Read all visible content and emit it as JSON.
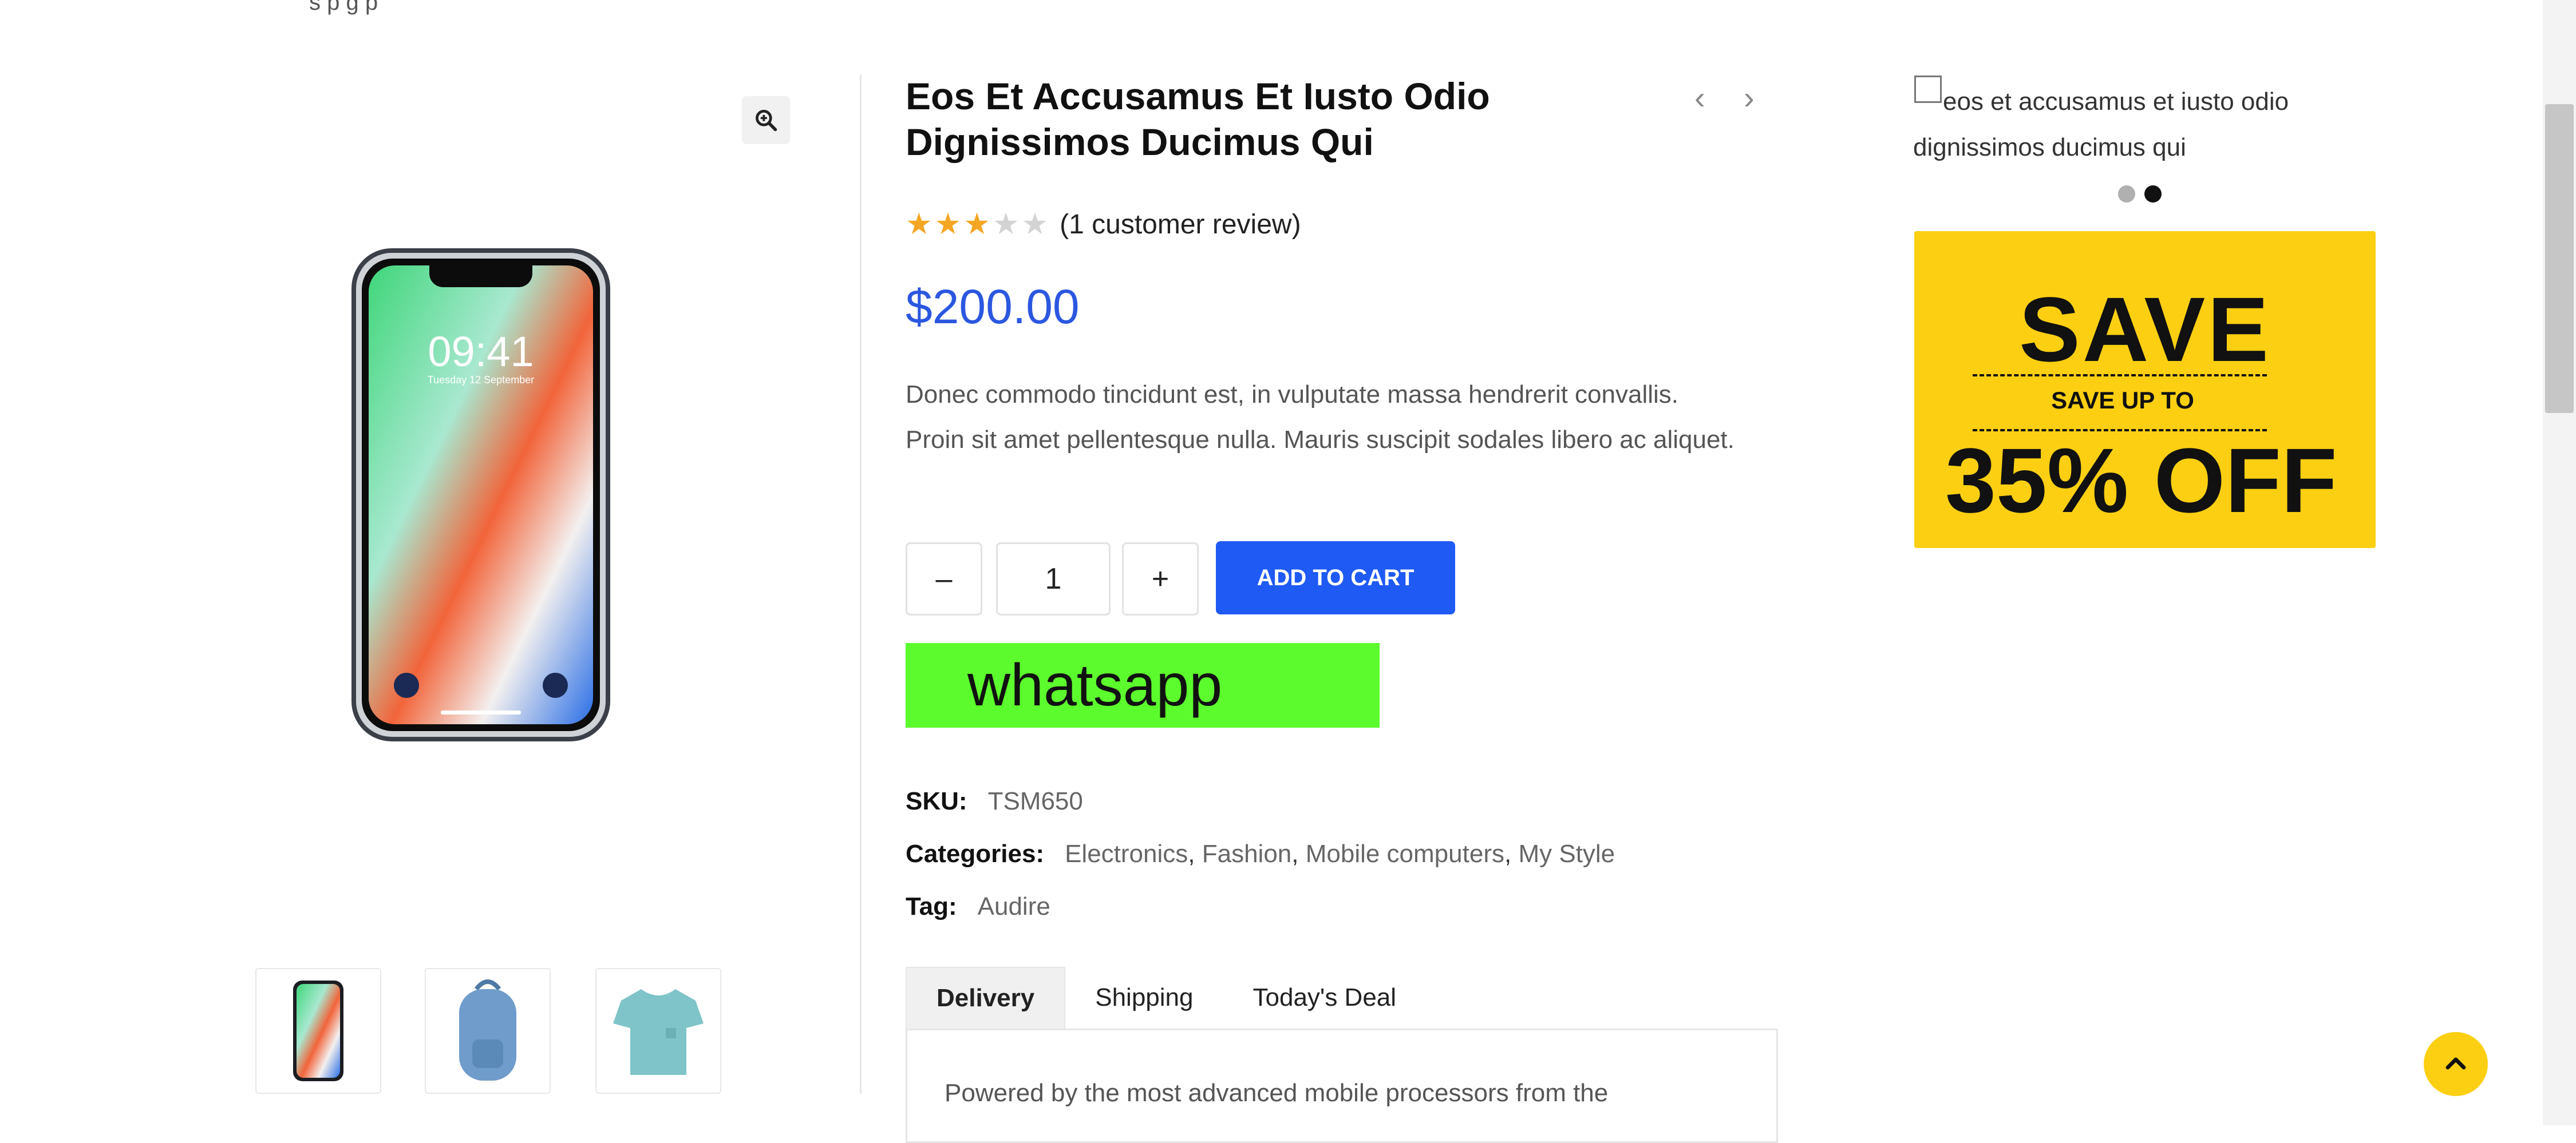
{
  "top_strip": {
    "text": "s  p                                            g            p"
  },
  "gallery": {
    "zoom_icon": "magnifier-plus-icon",
    "main_image": {
      "description": "smartphone",
      "time_text": "09:41",
      "date_text": "Tuesday 12 September"
    },
    "thumbnails": [
      "phone-thumbnail",
      "backpack-thumbnail",
      "tshirt-thumbnail"
    ]
  },
  "product": {
    "title": "Eos Et Accusamus Et Iusto Odio Dignissimos Ducimus Qui",
    "rating": 3,
    "rating_max": 5,
    "review_text": "(1 customer review)",
    "price": "$200.00",
    "description": "Donec commodo tincidunt est, in vulputate massa hendrerit convallis. Proin sit amet pellentesque nulla. Mauris suscipit sodales libero ac aliquet.",
    "quantity": "1",
    "qty_minus": "–",
    "qty_plus": "+",
    "add_to_cart": "ADD TO CART",
    "whatsapp": "whatsapp",
    "sku_label": "SKU:",
    "sku_value": "TSM650",
    "categories_label": "Categories:",
    "categories": [
      "Electronics",
      "Fashion",
      "Mobile computers",
      "My Style"
    ],
    "tag_label": "Tag:",
    "tag_value": "Audire",
    "nav_prev": "‹",
    "nav_next": "›"
  },
  "tabs": {
    "items": [
      "Delivery",
      "Shipping",
      "Today's Deal"
    ],
    "active": "Delivery",
    "content": "Powered by the most advanced mobile processors from the"
  },
  "sidebar": {
    "related_title": "eos et accusamus et iusto odio dignissimos ducimus qui",
    "promo": {
      "headline": "SAVE",
      "subline": "SAVE UP TO",
      "discount": "35% OFF",
      "bg_color": "#fccf13"
    }
  },
  "colors": {
    "price": "#2b57e0",
    "button": "#1f5af5",
    "whatsapp": "#5cfb2d",
    "accent": "#fccf13"
  }
}
